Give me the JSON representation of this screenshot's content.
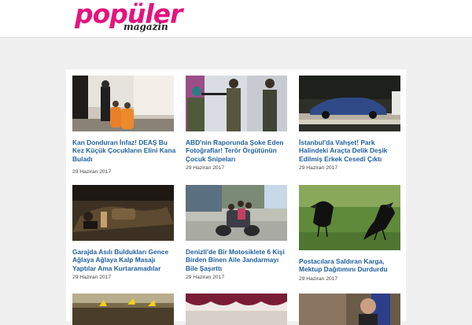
{
  "brand": {
    "name": "popüler",
    "sub": "magazin",
    "color": "#e5137e"
  },
  "articles": [
    {
      "title": "Kan Donduran İnfaz! DEAŞ Bu Kez Küçük Çocukların Elini Kana Buladı",
      "date": "29 Haziran 2017",
      "image": "children-in-orange-jumpsuits"
    },
    {
      "title": "ABD'nin Raporunda Şoke Eden Fotoğraflar! Terör Örgütünün Çocuk Snipeları",
      "date": "29 Haziran 2017",
      "image": "child-snipers"
    },
    {
      "title": "İstanbul'da Vahşet! Park Halindeki Araçta Delik Deşik Edilmiş Erkek Cesedi Çıktı",
      "date": "29 Haziran 2017",
      "image": "car-on-tow-truck"
    },
    {
      "title": "Garajda Asılı Buldukları Gence Ağlaya Ağlaya Kalp Masajı Yaptılar Ama Kurtaramadılar",
      "date": "29 Haziran 2017",
      "image": "garage-cpr"
    },
    {
      "title": "Denizli'de Bir Motosiklete 6 Kişi Birden Binen Aile Jandarmayı Bile Şaşırttı",
      "date": "29 Haziran 2017",
      "image": "family-on-motorcycle"
    },
    {
      "title": "Postacılara Saldıran Karga, Mektup Dağıtımını Durdurdu",
      "date": "29 Haziran 2017",
      "image": "crows"
    },
    {
      "title": "",
      "date": "",
      "image": "crowd-flags"
    },
    {
      "title": "",
      "date": "",
      "image": "tent-canopy"
    },
    {
      "title": "",
      "date": "",
      "image": "man-with-flag"
    }
  ]
}
